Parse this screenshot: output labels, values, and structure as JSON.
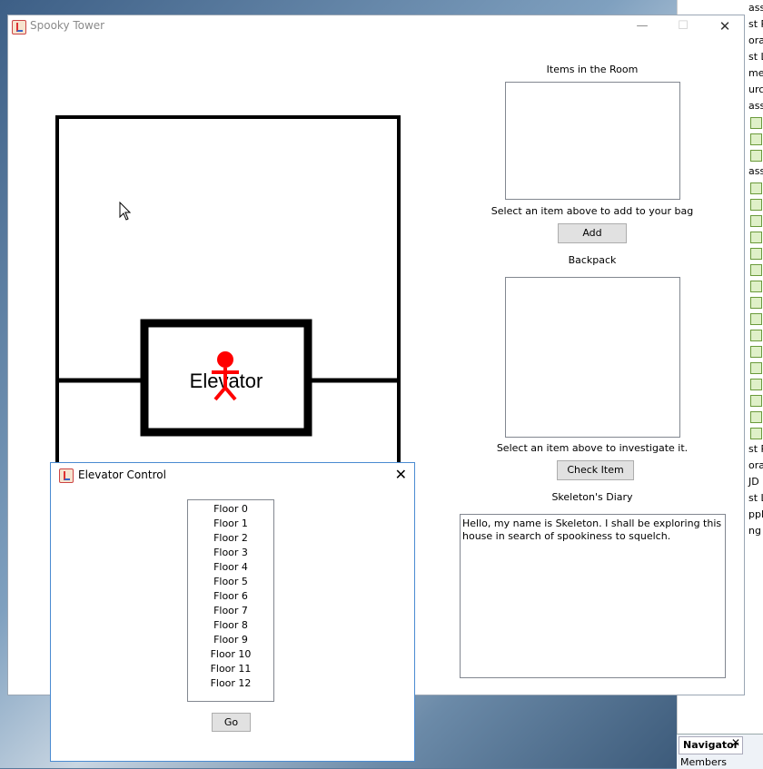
{
  "main_window": {
    "title": "Spooky Tower",
    "controls": {
      "minimize": "—",
      "maximize": "☐",
      "close": "✕"
    }
  },
  "tower": {
    "elevator_label": "Elevator"
  },
  "room_panel": {
    "items_label": "Items in the Room",
    "items_hint": "Select an item above to add to your bag",
    "add_button": "Add",
    "backpack_label": "Backpack",
    "backpack_hint": "Select an item above to investigate it.",
    "check_button": "Check Item",
    "diary_label": "Skeleton's Diary",
    "diary_text": "Hello, my name is Skeleton. I shall be exploring this house in search of spookiness to squelch."
  },
  "elevator_control": {
    "title": "Elevator Control",
    "close": "✕",
    "floors": [
      "Floor 0",
      "Floor 1",
      "Floor 2",
      "Floor 3",
      "Floor 4",
      "Floor 5",
      "Floor 6",
      "Floor 7",
      "Floor 8",
      "Floor 9",
      "Floor 10",
      "Floor 11",
      "Floor 12"
    ],
    "go_button": "Go"
  },
  "ide": {
    "rows": [
      "ass",
      "st Pa",
      "orarie",
      "st Li",
      "men",
      "urce",
      "ass",
      "",
      "",
      "",
      "ass",
      "",
      "",
      "",
      "",
      "",
      "",
      "",
      "",
      "",
      "",
      "",
      "",
      "",
      "",
      "",
      "",
      "st Pa",
      "orarie",
      "JD",
      "st Li",
      "pplic",
      "ng"
    ],
    "navigator_tab": "Navigator",
    "navigator_close": "✕",
    "members": "Members"
  },
  "colors": {
    "stick_figure": "#ff0000",
    "window_border_active": "#4a8bd1"
  }
}
